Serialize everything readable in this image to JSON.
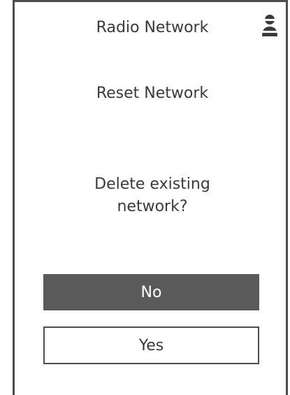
{
  "header": {
    "title": "Radio Network",
    "icon": "user-icon"
  },
  "main": {
    "heading": "Reset Network",
    "prompt": "Delete existing\nnetwork?"
  },
  "buttons": {
    "no_label": "No",
    "yes_label": "Yes"
  },
  "colors": {
    "primary_button_bg": "#5a5a5a",
    "frame_border": "#4d4d4d",
    "text": "#3a3a3a"
  }
}
